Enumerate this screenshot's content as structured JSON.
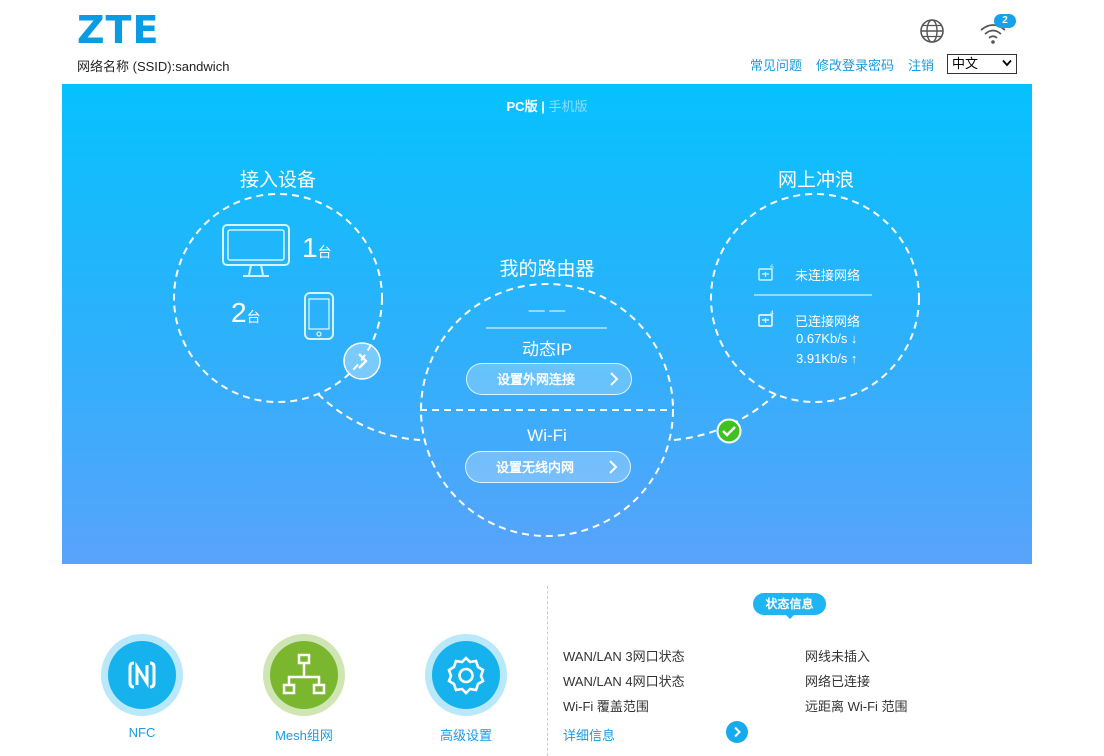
{
  "header": {
    "logo": "ZTE",
    "ssid_label": "网络名称 (SSID):sandwich",
    "links": {
      "faq": "常见问题",
      "change_password": "修改登录密码",
      "logout": "注销"
    },
    "language": "中文",
    "wifi_badge": "2",
    "icons": {
      "globe": "globe-icon",
      "wifi": "wifi-icon"
    }
  },
  "banner": {
    "view_switch": {
      "pc": "PC版",
      "sep": "|",
      "mobile": "手机版"
    },
    "devices": {
      "title": "接入设备",
      "pc_count": "1",
      "phone_count": "2",
      "unit": "台"
    },
    "router": {
      "title": "我的路由器",
      "wan_value": "— —",
      "wan_mode": "动态IP",
      "wan_button": "设置外网连接",
      "wifi_title": "Wi-Fi",
      "wifi_button": "设置无线内网"
    },
    "internet": {
      "title": "网上冲浪",
      "row1": "未连接网络",
      "row2": "已连接网络",
      "down": "0.67Kb/s ↓",
      "up": "3.91Kb/s ↑"
    }
  },
  "bottom": {
    "tiles": [
      {
        "label": "NFC",
        "color": "#15b2ee",
        "icon": "nfc-icon"
      },
      {
        "label": "Mesh组网",
        "color": "#7ab72f",
        "icon": "mesh-icon"
      },
      {
        "label": "高级设置",
        "color": "#15b2ee",
        "icon": "gear-icon"
      }
    ],
    "status": {
      "tag": "状态信息",
      "rows": [
        {
          "label": "WAN/LAN 3网口状态",
          "value": "网线未插入"
        },
        {
          "label": "WAN/LAN 4网口状态",
          "value": "网络已连接"
        },
        {
          "label": "Wi-Fi 覆盖范围",
          "value": "远距离 Wi-Fi 范围"
        }
      ],
      "detail": "详细信息"
    }
  },
  "colors": {
    "accent": "#1a9be0",
    "banner_top": "#06c1fe",
    "banner_bottom": "#59a3fb",
    "mesh": "#7ab72f"
  }
}
